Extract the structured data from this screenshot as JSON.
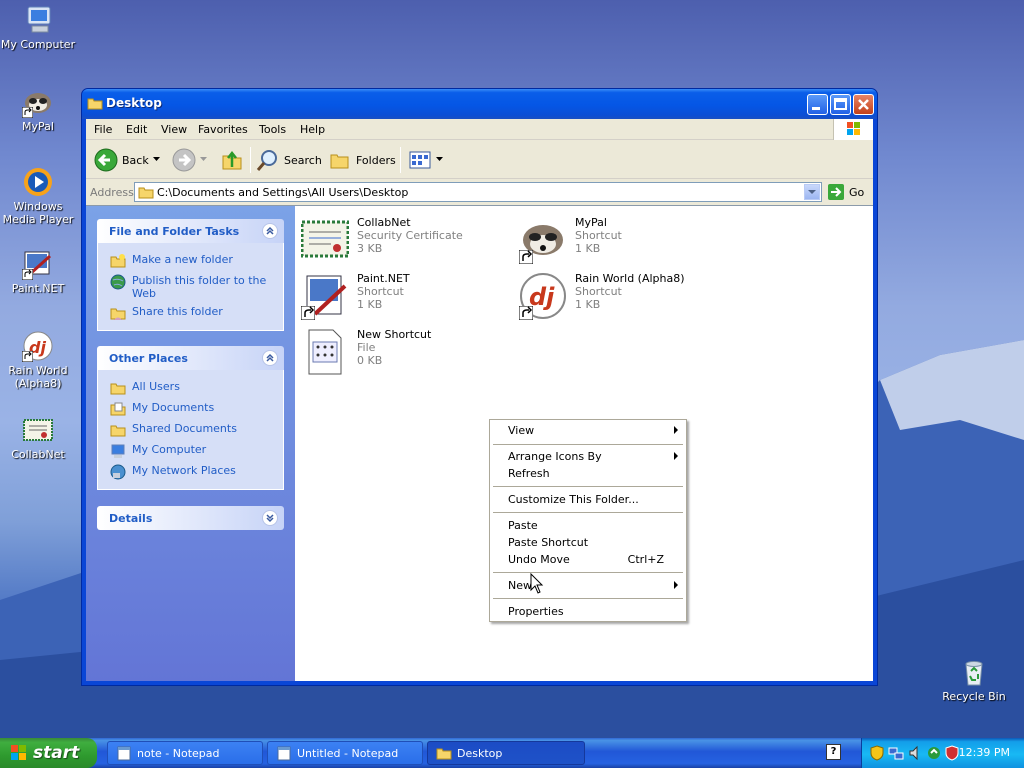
{
  "desktop": {
    "icons": [
      {
        "label": "My Computer"
      },
      {
        "label": "MyPal"
      },
      {
        "label": "Windows Media Player"
      },
      {
        "label": "Paint.NET"
      },
      {
        "label": "Rain World (Alpha8)"
      },
      {
        "label": "CollabNet"
      },
      {
        "label": "Recycle Bin"
      }
    ]
  },
  "window": {
    "title": "Desktop",
    "menu": [
      "File",
      "Edit",
      "View",
      "Favorites",
      "Tools",
      "Help"
    ],
    "toolbar": {
      "back": "Back",
      "search": "Search",
      "folders": "Folders"
    },
    "address": {
      "label": "Address",
      "value": "C:\\Documents and Settings\\All Users\\Desktop",
      "go": "Go"
    },
    "panels": {
      "tasks": {
        "title": "File and Folder Tasks",
        "items": [
          "Make a new folder",
          "Publish this folder to the Web",
          "Share this folder"
        ]
      },
      "places": {
        "title": "Other Places",
        "items": [
          "All Users",
          "My Documents",
          "Shared Documents",
          "My Computer",
          "My Network Places"
        ]
      },
      "details": {
        "title": "Details"
      }
    },
    "files": [
      {
        "name": "CollabNet",
        "type": "Security Certificate",
        "size": "3 KB"
      },
      {
        "name": "MyPal",
        "type": "Shortcut",
        "size": "1 KB"
      },
      {
        "name": "Paint.NET",
        "type": "Shortcut",
        "size": "1 KB"
      },
      {
        "name": "Rain World (Alpha8)",
        "type": "Shortcut",
        "size": "1 KB"
      },
      {
        "name": "New Shortcut",
        "type": "File",
        "size": "0 KB"
      }
    ]
  },
  "context_menu": {
    "items": [
      "View",
      "Arrange Icons By",
      "Refresh",
      "Customize This Folder...",
      "Paste",
      "Paste Shortcut",
      "Undo Move",
      "New",
      "Properties"
    ],
    "undo_shortcut": "Ctrl+Z"
  },
  "taskbar": {
    "start": "start",
    "tasks": [
      "note - Notepad",
      "Untitled - Notepad",
      "Desktop"
    ],
    "clock": "12:39 PM"
  },
  "colors": {
    "title_blue": "#0a5ee9",
    "task_pane_link": "#215dc6",
    "start_green": "#3fae3f"
  }
}
